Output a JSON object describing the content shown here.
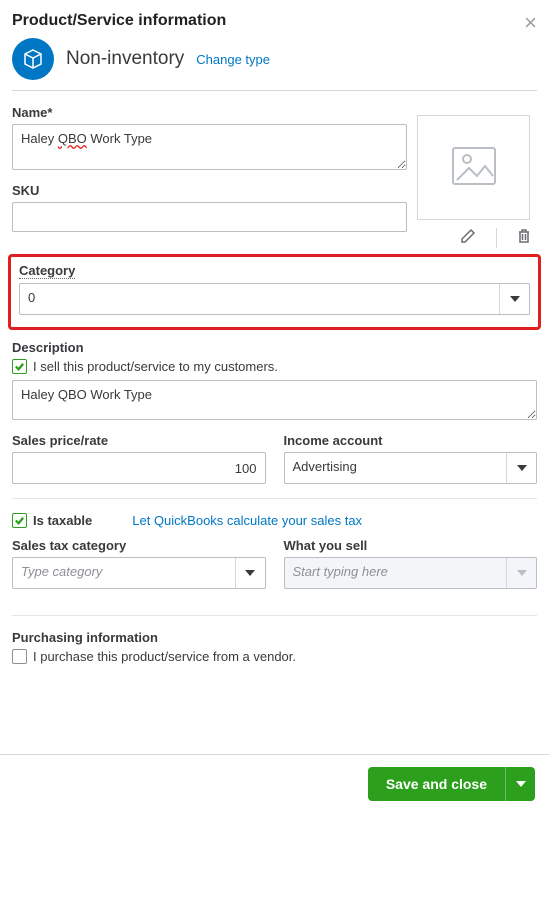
{
  "header": {
    "title": "Product/Service information"
  },
  "type": {
    "label": "Non-inventory",
    "change_link": "Change type"
  },
  "name": {
    "label": "Name*",
    "value_pre": "Haley ",
    "value_qbo": "QBO",
    "value_post": " Work Type"
  },
  "sku": {
    "label": "SKU",
    "value": ""
  },
  "category": {
    "label": "Category",
    "value": "0"
  },
  "description": {
    "heading": "Description",
    "checkbox_label": "I sell this product/service to my customers.",
    "value": "Haley QBO Work Type"
  },
  "sales": {
    "price_label": "Sales price/rate",
    "price_value": "100",
    "income_label": "Income account",
    "income_value": "Advertising"
  },
  "tax": {
    "taxable_label": "Is taxable",
    "calc_link": "Let QuickBooks calculate your sales tax",
    "category_label": "Sales tax category",
    "category_placeholder": "Type category",
    "what_label": "What you sell",
    "what_placeholder": "Start typing here"
  },
  "purchasing": {
    "heading": "Purchasing information",
    "checkbox_label": "I purchase this product/service from a vendor."
  },
  "footer": {
    "save_label": "Save and close"
  }
}
